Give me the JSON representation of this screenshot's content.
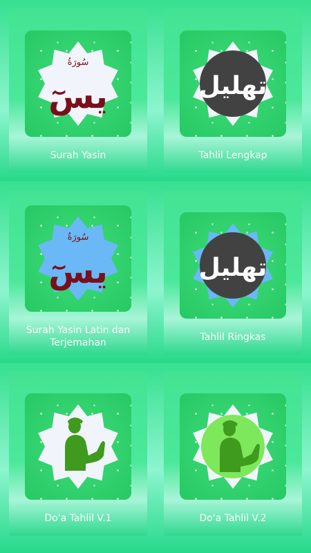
{
  "menu": {
    "items": [
      {
        "label": "Surah Yasin",
        "icon": "surah-yasin-calligraphy-icon",
        "icon_arabic": "يسٓ",
        "icon_top": "سُورَةُ"
      },
      {
        "label": "Tahlil Lengkap",
        "icon": "tahlil-calligraphy-icon",
        "icon_arabic": "تهليل"
      },
      {
        "label": "Surah  Yasin Latin dan Terjemahan",
        "label_line1": "Surah  Yasin Latin dan",
        "label_line2": "Terjemahan",
        "icon": "surah-yasin-calligraphy-icon",
        "icon_arabic": "يسٓ",
        "icon_top": "سُورَةُ"
      },
      {
        "label": "Tahlil Ringkas",
        "icon": "tahlil-calligraphy-icon",
        "icon_arabic": "تهليل"
      },
      {
        "label": "Do'a Tahlil V.1",
        "icon": "praying-man-icon"
      },
      {
        "label": "Do'a Tahlil V.2",
        "icon": "praying-man-icon"
      }
    ]
  },
  "colors": {
    "background_top": "#36e08f",
    "background_mid": "#8df5cf",
    "tile_green": "#2fcf6d",
    "star_white": "#f1f5fb",
    "star_blue": "#6ab8f5",
    "circle_dark": "#424242",
    "circle_light_green": "#7ee85c",
    "figure_green": "#3e9b1d",
    "calligraphy_red": "#7a0f1a",
    "label_text": "#ffffff"
  }
}
